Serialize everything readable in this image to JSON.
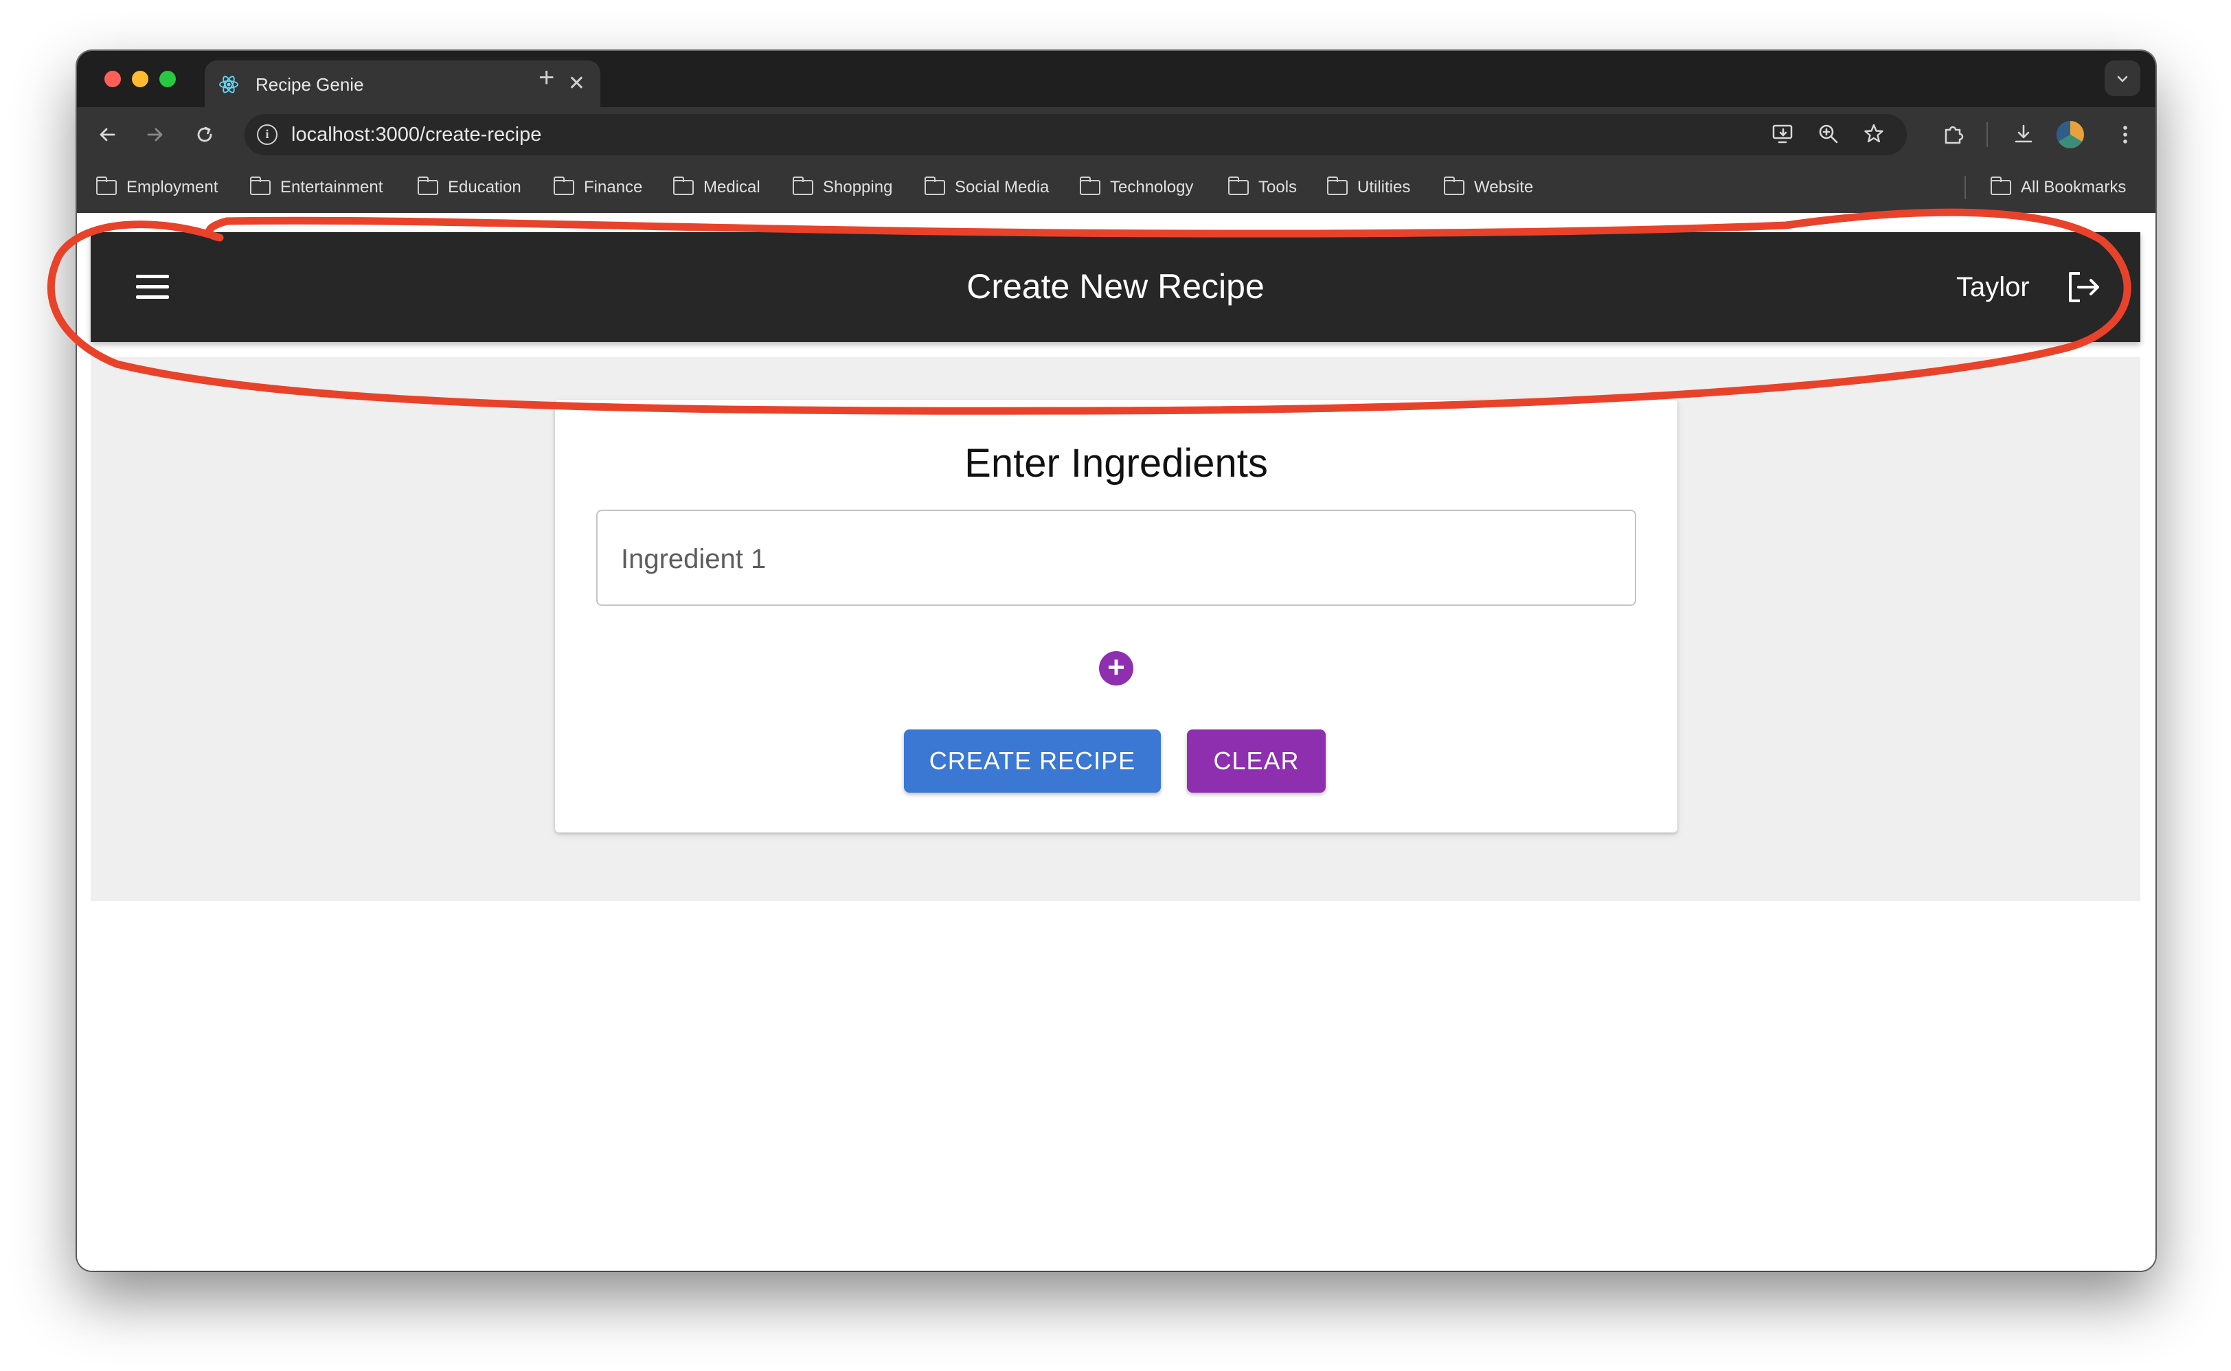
{
  "browser": {
    "tab_title": "Recipe Genie",
    "tab_close": "✕",
    "new_tab": "+",
    "url": "localhost:3000/create-recipe",
    "bookmarks": [
      "Employment",
      "Entertainment",
      "Education",
      "Finance",
      "Medical",
      "Shopping",
      "Social Media",
      "Technology",
      "Tools",
      "Utilities",
      "Website"
    ],
    "all_bookmarks": "All Bookmarks"
  },
  "app": {
    "title": "Create New Recipe",
    "username": "Taylor"
  },
  "form": {
    "heading": "Enter Ingredients",
    "ingredient_placeholder": "Ingredient 1",
    "add_symbol": "+",
    "create_label": "CREATE RECIPE",
    "clear_label": "CLEAR"
  },
  "colors": {
    "appbar": "#272727",
    "primary": "#3a78d4",
    "secondary": "#8e2fb0",
    "annotation": "#e8432a"
  }
}
